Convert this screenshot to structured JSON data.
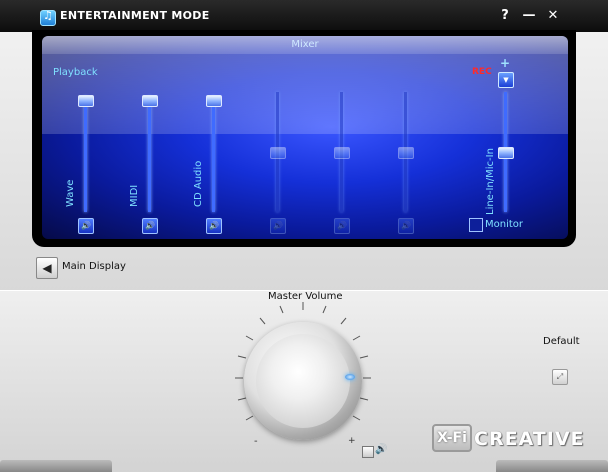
{
  "window": {
    "title": "ENTERTAINMENT MODE",
    "buttons": {
      "help": "?",
      "minimize": "—",
      "close": "✕"
    }
  },
  "mixer": {
    "title": "Mixer",
    "playback_label": "Playback",
    "rec_label": "REC",
    "rec_plus": "+",
    "channels": [
      {
        "name": "Wave",
        "level": 1.0,
        "enabled": true
      },
      {
        "name": "MIDI",
        "level": 1.0,
        "enabled": true
      },
      {
        "name": "CD Audio",
        "level": 1.0,
        "enabled": true
      },
      {
        "name": "",
        "level": 0.55,
        "enabled": false
      },
      {
        "name": "",
        "level": 0.55,
        "enabled": false
      },
      {
        "name": "",
        "level": 0.55,
        "enabled": false
      },
      {
        "name": "Line-In/Mic-In",
        "level": 0.55,
        "enabled": true
      }
    ],
    "monitor_label": "Monitor"
  },
  "nav": {
    "main_display_label": "Main Display"
  },
  "volume": {
    "title": "Master Volume",
    "minus": "-",
    "plus": "+",
    "default_label": "Default"
  },
  "brand": {
    "xfi": "X-Fi",
    "creative": "CREATIVE"
  }
}
